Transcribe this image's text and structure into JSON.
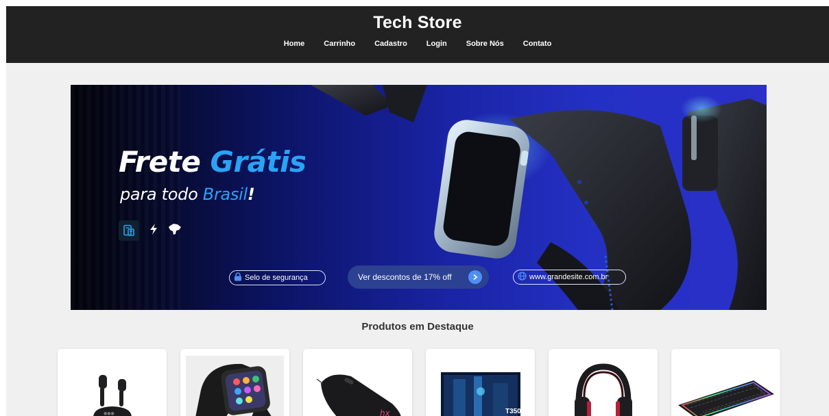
{
  "header": {
    "title": "Tech Store",
    "nav": [
      "Home",
      "Carrinho",
      "Cadastro",
      "Login",
      "Sobre Nós",
      "Contato"
    ]
  },
  "banner": {
    "headline_word1": "Frete",
    "headline_word2": "Grátis",
    "subline_part1": "para todo ",
    "subline_part2": "Brasil",
    "subline_part3": "!",
    "security_label": "Selo de segurança",
    "cta_label": "Ver descontos de 17% off",
    "site_label": "www.grandesite.com.br",
    "icons": [
      "invoice-icon",
      "lightning-icon",
      "brazil-map-icon"
    ]
  },
  "section": {
    "title": "Produtos em Destaque"
  },
  "products": [
    {
      "icon": "earbuds-image"
    },
    {
      "icon": "smartwatch-image"
    },
    {
      "icon": "gaming-mouse-image"
    },
    {
      "icon": "monitor-image",
      "label": "T350"
    },
    {
      "icon": "headset-image"
    },
    {
      "icon": "keyboard-image"
    }
  ],
  "colors": {
    "header_bg": "#222222",
    "accent_blue": "#2aa3f5",
    "page_bg": "#f0f0f0"
  }
}
